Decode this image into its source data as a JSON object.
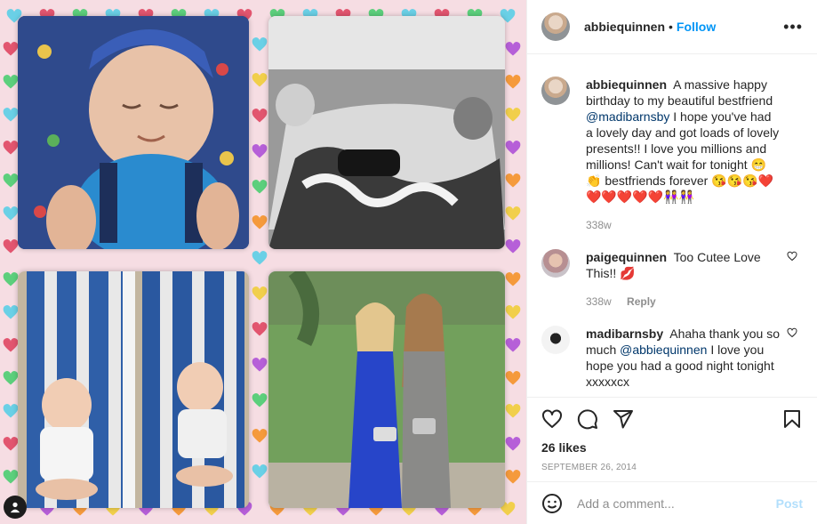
{
  "post": {
    "username": "abbiequinnen",
    "separator": "•",
    "follow_label": "Follow",
    "more_label": "•••",
    "colors": {
      "accent": "#0095f6",
      "text": "#262626",
      "muted": "#8e8e8e",
      "post_disabled": "#b2dffc",
      "mention": "#00376b"
    }
  },
  "caption": {
    "username": "abbiequinnen",
    "text_1": "A massive happy birthday to my beautiful bestfriend",
    "mention": "@madibarnsby",
    "text_2": "I hope you've had a lovely day and got loads of lovely presents!! I love you millions and millions! Can't wait for tonight 😁👏 bestfriends forever 😘😘😘❤️❤️❤️❤️❤️❤️👭👭",
    "time": "338w"
  },
  "comments": [
    {
      "username": "paigequinnen",
      "text": "Too Cutee Love This!! 💋",
      "time": "338w",
      "reply_label": "Reply"
    },
    {
      "username": "madibarnsby",
      "text_1": "Ahaha thank you so much",
      "mention": "@abbiequinnen",
      "text_2": "I love you hope you had a good night tonight xxxxxcx"
    }
  ],
  "footer": {
    "likes": "26 likes",
    "date": "September 26, 2014",
    "comment_placeholder": "Add a comment...",
    "post_label": "Post"
  },
  "icons": [
    "heart-icon",
    "comment-icon",
    "share-icon",
    "bookmark-icon",
    "emoji-icon",
    "user-tag-icon",
    "more-icon"
  ]
}
